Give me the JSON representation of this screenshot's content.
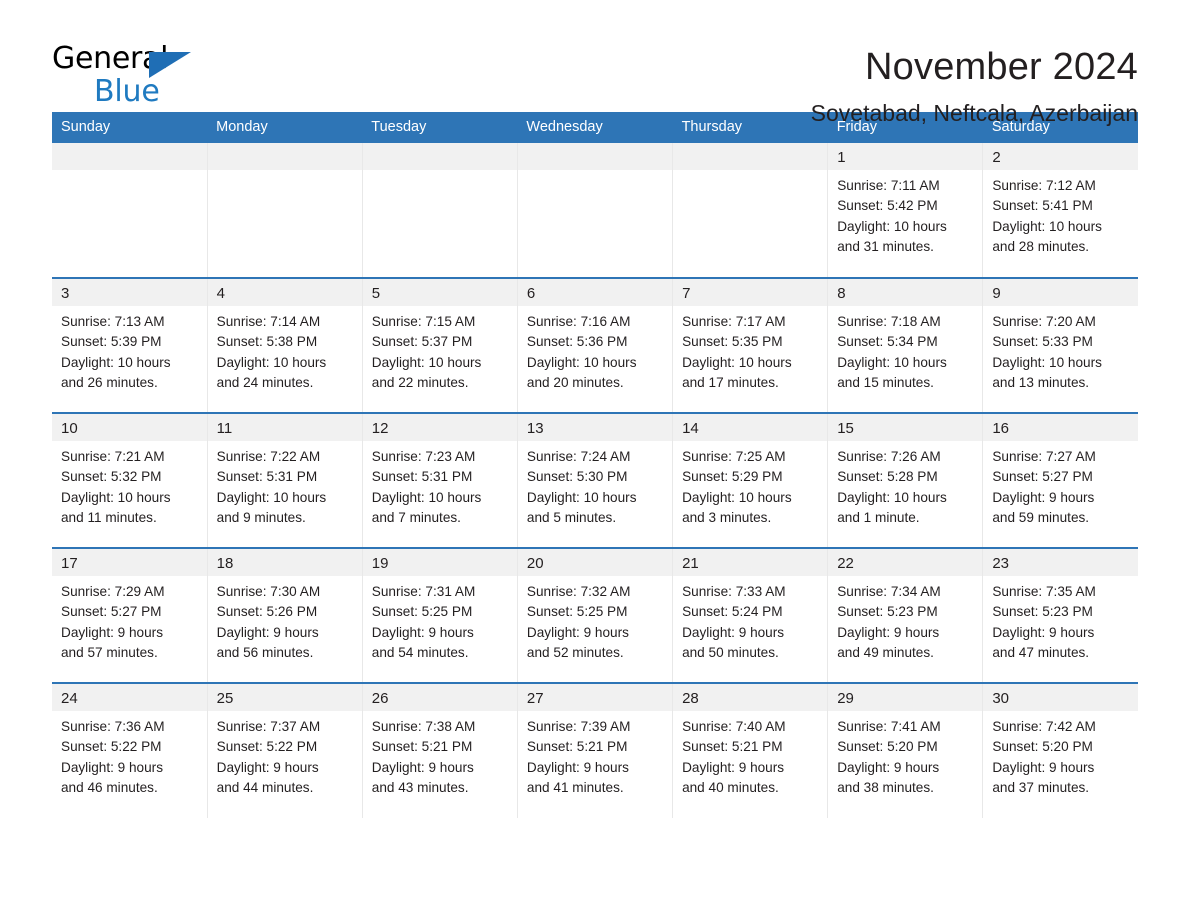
{
  "brand": {
    "name_part1": "General",
    "name_part2": "Blue",
    "triangle_icon": "blue-triangle-logo-mark",
    "accent_color": "#1f7ac0"
  },
  "header": {
    "month_title": "November 2024",
    "location": "Sovetabad, Neftcala, Azerbaijan"
  },
  "theme": {
    "header_bg": "#2e75b6",
    "header_text": "#ffffff",
    "daynum_band_bg": "#f1f1f1",
    "week_divider": "#2e75b6",
    "cell_bg": "#ffffff",
    "text": "#231f20"
  },
  "calendar": {
    "type": "month-grid",
    "month": "November",
    "year": 2024,
    "weekday_headers": [
      "Sunday",
      "Monday",
      "Tuesday",
      "Wednesday",
      "Thursday",
      "Friday",
      "Saturday"
    ],
    "weeks": [
      [
        {
          "day": "",
          "sunrise": "",
          "sunset": "",
          "daylight_line1": "",
          "daylight_line2": "",
          "empty": true
        },
        {
          "day": "",
          "sunrise": "",
          "sunset": "",
          "daylight_line1": "",
          "daylight_line2": "",
          "empty": true
        },
        {
          "day": "",
          "sunrise": "",
          "sunset": "",
          "daylight_line1": "",
          "daylight_line2": "",
          "empty": true
        },
        {
          "day": "",
          "sunrise": "",
          "sunset": "",
          "daylight_line1": "",
          "daylight_line2": "",
          "empty": true
        },
        {
          "day": "",
          "sunrise": "",
          "sunset": "",
          "daylight_line1": "",
          "daylight_line2": "",
          "empty": true
        },
        {
          "day": "1",
          "sunrise": "Sunrise: 7:11 AM",
          "sunset": "Sunset: 5:42 PM",
          "daylight_line1": "Daylight: 10 hours",
          "daylight_line2": "and 31 minutes."
        },
        {
          "day": "2",
          "sunrise": "Sunrise: 7:12 AM",
          "sunset": "Sunset: 5:41 PM",
          "daylight_line1": "Daylight: 10 hours",
          "daylight_line2": "and 28 minutes."
        }
      ],
      [
        {
          "day": "3",
          "sunrise": "Sunrise: 7:13 AM",
          "sunset": "Sunset: 5:39 PM",
          "daylight_line1": "Daylight: 10 hours",
          "daylight_line2": "and 26 minutes."
        },
        {
          "day": "4",
          "sunrise": "Sunrise: 7:14 AM",
          "sunset": "Sunset: 5:38 PM",
          "daylight_line1": "Daylight: 10 hours",
          "daylight_line2": "and 24 minutes."
        },
        {
          "day": "5",
          "sunrise": "Sunrise: 7:15 AM",
          "sunset": "Sunset: 5:37 PM",
          "daylight_line1": "Daylight: 10 hours",
          "daylight_line2": "and 22 minutes."
        },
        {
          "day": "6",
          "sunrise": "Sunrise: 7:16 AM",
          "sunset": "Sunset: 5:36 PM",
          "daylight_line1": "Daylight: 10 hours",
          "daylight_line2": "and 20 minutes."
        },
        {
          "day": "7",
          "sunrise": "Sunrise: 7:17 AM",
          "sunset": "Sunset: 5:35 PM",
          "daylight_line1": "Daylight: 10 hours",
          "daylight_line2": "and 17 minutes."
        },
        {
          "day": "8",
          "sunrise": "Sunrise: 7:18 AM",
          "sunset": "Sunset: 5:34 PM",
          "daylight_line1": "Daylight: 10 hours",
          "daylight_line2": "and 15 minutes."
        },
        {
          "day": "9",
          "sunrise": "Sunrise: 7:20 AM",
          "sunset": "Sunset: 5:33 PM",
          "daylight_line1": "Daylight: 10 hours",
          "daylight_line2": "and 13 minutes."
        }
      ],
      [
        {
          "day": "10",
          "sunrise": "Sunrise: 7:21 AM",
          "sunset": "Sunset: 5:32 PM",
          "daylight_line1": "Daylight: 10 hours",
          "daylight_line2": "and 11 minutes."
        },
        {
          "day": "11",
          "sunrise": "Sunrise: 7:22 AM",
          "sunset": "Sunset: 5:31 PM",
          "daylight_line1": "Daylight: 10 hours",
          "daylight_line2": "and 9 minutes."
        },
        {
          "day": "12",
          "sunrise": "Sunrise: 7:23 AM",
          "sunset": "Sunset: 5:31 PM",
          "daylight_line1": "Daylight: 10 hours",
          "daylight_line2": "and 7 minutes."
        },
        {
          "day": "13",
          "sunrise": "Sunrise: 7:24 AM",
          "sunset": "Sunset: 5:30 PM",
          "daylight_line1": "Daylight: 10 hours",
          "daylight_line2": "and 5 minutes."
        },
        {
          "day": "14",
          "sunrise": "Sunrise: 7:25 AM",
          "sunset": "Sunset: 5:29 PM",
          "daylight_line1": "Daylight: 10 hours",
          "daylight_line2": "and 3 minutes."
        },
        {
          "day": "15",
          "sunrise": "Sunrise: 7:26 AM",
          "sunset": "Sunset: 5:28 PM",
          "daylight_line1": "Daylight: 10 hours",
          "daylight_line2": "and 1 minute."
        },
        {
          "day": "16",
          "sunrise": "Sunrise: 7:27 AM",
          "sunset": "Sunset: 5:27 PM",
          "daylight_line1": "Daylight: 9 hours",
          "daylight_line2": "and 59 minutes."
        }
      ],
      [
        {
          "day": "17",
          "sunrise": "Sunrise: 7:29 AM",
          "sunset": "Sunset: 5:27 PM",
          "daylight_line1": "Daylight: 9 hours",
          "daylight_line2": "and 57 minutes."
        },
        {
          "day": "18",
          "sunrise": "Sunrise: 7:30 AM",
          "sunset": "Sunset: 5:26 PM",
          "daylight_line1": "Daylight: 9 hours",
          "daylight_line2": "and 56 minutes."
        },
        {
          "day": "19",
          "sunrise": "Sunrise: 7:31 AM",
          "sunset": "Sunset: 5:25 PM",
          "daylight_line1": "Daylight: 9 hours",
          "daylight_line2": "and 54 minutes."
        },
        {
          "day": "20",
          "sunrise": "Sunrise: 7:32 AM",
          "sunset": "Sunset: 5:25 PM",
          "daylight_line1": "Daylight: 9 hours",
          "daylight_line2": "and 52 minutes."
        },
        {
          "day": "21",
          "sunrise": "Sunrise: 7:33 AM",
          "sunset": "Sunset: 5:24 PM",
          "daylight_line1": "Daylight: 9 hours",
          "daylight_line2": "and 50 minutes."
        },
        {
          "day": "22",
          "sunrise": "Sunrise: 7:34 AM",
          "sunset": "Sunset: 5:23 PM",
          "daylight_line1": "Daylight: 9 hours",
          "daylight_line2": "and 49 minutes."
        },
        {
          "day": "23",
          "sunrise": "Sunrise: 7:35 AM",
          "sunset": "Sunset: 5:23 PM",
          "daylight_line1": "Daylight: 9 hours",
          "daylight_line2": "and 47 minutes."
        }
      ],
      [
        {
          "day": "24",
          "sunrise": "Sunrise: 7:36 AM",
          "sunset": "Sunset: 5:22 PM",
          "daylight_line1": "Daylight: 9 hours",
          "daylight_line2": "and 46 minutes."
        },
        {
          "day": "25",
          "sunrise": "Sunrise: 7:37 AM",
          "sunset": "Sunset: 5:22 PM",
          "daylight_line1": "Daylight: 9 hours",
          "daylight_line2": "and 44 minutes."
        },
        {
          "day": "26",
          "sunrise": "Sunrise: 7:38 AM",
          "sunset": "Sunset: 5:21 PM",
          "daylight_line1": "Daylight: 9 hours",
          "daylight_line2": "and 43 minutes."
        },
        {
          "day": "27",
          "sunrise": "Sunrise: 7:39 AM",
          "sunset": "Sunset: 5:21 PM",
          "daylight_line1": "Daylight: 9 hours",
          "daylight_line2": "and 41 minutes."
        },
        {
          "day": "28",
          "sunrise": "Sunrise: 7:40 AM",
          "sunset": "Sunset: 5:21 PM",
          "daylight_line1": "Daylight: 9 hours",
          "daylight_line2": "and 40 minutes."
        },
        {
          "day": "29",
          "sunrise": "Sunrise: 7:41 AM",
          "sunset": "Sunset: 5:20 PM",
          "daylight_line1": "Daylight: 9 hours",
          "daylight_line2": "and 38 minutes."
        },
        {
          "day": "30",
          "sunrise": "Sunrise: 7:42 AM",
          "sunset": "Sunset: 5:20 PM",
          "daylight_line1": "Daylight: 9 hours",
          "daylight_line2": "and 37 minutes."
        }
      ]
    ]
  }
}
